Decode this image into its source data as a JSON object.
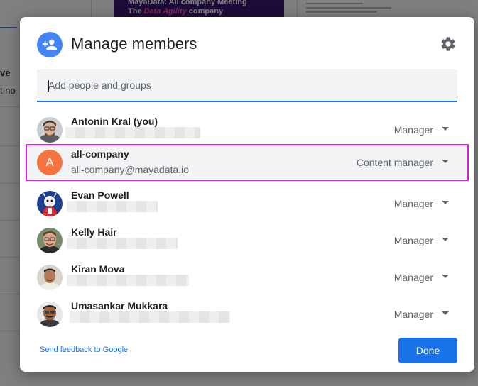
{
  "background": {
    "banner_line1": "MayaData: All company Meeting",
    "banner_line2_prefix": "The",
    "banner_line2_accent": "Data Agility",
    "banner_line2_suffix": "company",
    "left_heading": "ve",
    "left_text": "t no"
  },
  "dialog": {
    "title": "Manage members",
    "add_placeholder": "Add people and groups",
    "feedback_link": "Send feedback to Google",
    "done_label": "Done"
  },
  "members": [
    {
      "name": "Antonin Kral (you)",
      "role": "Manager",
      "avatar_icon": "antonin-avatar-icon"
    },
    {
      "name": "all-company",
      "email": "all-company@mayadata.io",
      "role": "Content manager",
      "avatar_letter": "A",
      "avatar_color": "#f4733f",
      "selected": true
    },
    {
      "name": "Evan Powell",
      "role": "Manager",
      "avatar_icon": "evan-avatar-icon"
    },
    {
      "name": "Kelly Hair",
      "role": "Manager",
      "avatar_icon": "kelly-avatar-icon"
    },
    {
      "name": "Kiran Mova",
      "role": "Manager",
      "avatar_icon": "kiran-avatar-icon"
    },
    {
      "name": "Umasankar Mukkara",
      "role": "Manager",
      "avatar_icon": "umasankar-avatar-icon"
    }
  ],
  "colors": {
    "accent": "#1a73e8",
    "header_icon_bg": "#4285f4",
    "selection_border": "#d81ed8",
    "row_highlight": "#f1f3f4"
  }
}
